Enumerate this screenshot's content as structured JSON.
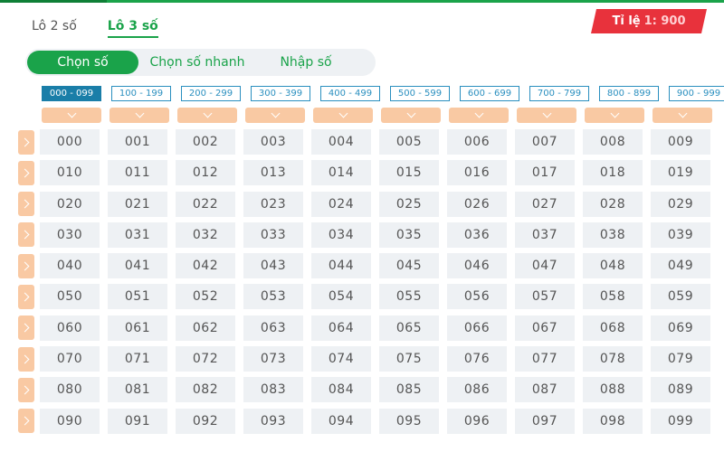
{
  "lo_tabs": [
    {
      "label": "Lô 2 số",
      "active": false
    },
    {
      "label": "Lô 3 số",
      "active": true
    }
  ],
  "ratio": {
    "label": "Tỉ lệ",
    "value": "1: 900"
  },
  "modes": [
    {
      "label": "Chọn số",
      "active": true
    },
    {
      "label": "Chọn số nhanh",
      "active": false
    },
    {
      "label": "Nhập số",
      "active": false
    }
  ],
  "ranges": [
    "000 - 099",
    "100 - 199",
    "200 - 299",
    "300 - 399",
    "400 - 499",
    "500 - 599",
    "600 - 699",
    "700 - 799",
    "800 - 899",
    "900 - 999"
  ],
  "active_range": 0,
  "grid": [
    [
      "000",
      "001",
      "002",
      "003",
      "004",
      "005",
      "006",
      "007",
      "008",
      "009"
    ],
    [
      "010",
      "011",
      "012",
      "013",
      "014",
      "015",
      "016",
      "017",
      "018",
      "019"
    ],
    [
      "020",
      "021",
      "022",
      "023",
      "024",
      "025",
      "026",
      "027",
      "028",
      "029"
    ],
    [
      "030",
      "031",
      "032",
      "033",
      "034",
      "035",
      "036",
      "037",
      "038",
      "039"
    ],
    [
      "040",
      "041",
      "042",
      "043",
      "044",
      "045",
      "046",
      "047",
      "048",
      "049"
    ],
    [
      "050",
      "051",
      "052",
      "053",
      "054",
      "055",
      "056",
      "057",
      "058",
      "059"
    ],
    [
      "060",
      "061",
      "062",
      "063",
      "064",
      "065",
      "066",
      "067",
      "068",
      "069"
    ],
    [
      "070",
      "071",
      "072",
      "073",
      "074",
      "075",
      "076",
      "077",
      "078",
      "079"
    ],
    [
      "080",
      "081",
      "082",
      "083",
      "084",
      "085",
      "086",
      "087",
      "088",
      "089"
    ],
    [
      "090",
      "091",
      "092",
      "093",
      "094",
      "095",
      "096",
      "097",
      "098",
      "099"
    ]
  ],
  "colors": {
    "accent": "#1aa34a",
    "badge": "#e8323c",
    "range_active": "#1a7ea8",
    "chevron_bg": "#f9c9a3"
  },
  "icons": {
    "column": "chevron-down-icon",
    "row": "chevron-right-icon"
  }
}
